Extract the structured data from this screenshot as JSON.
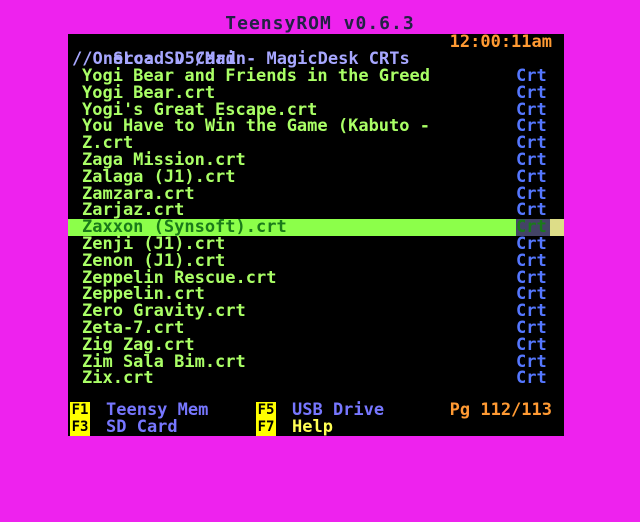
{
  "window": {
    "title": "TeensyROM v0.6.3"
  },
  "header": {
    "source": "Src: SD Card",
    "clock": "12:00:11am",
    "path": "//OneLoad v5/Main- MagicDesk CRTs"
  },
  "files": [
    {
      "name": "Yogi Bear and Friends in the Greed",
      "type": "Crt"
    },
    {
      "name": "Yogi Bear.crt",
      "type": "Crt"
    },
    {
      "name": "Yogi's Great Escape.crt",
      "type": "Crt"
    },
    {
      "name": "You Have to Win the Game (Kabuto -",
      "type": "Crt"
    },
    {
      "name": "Z.crt",
      "type": "Crt"
    },
    {
      "name": "Zaga Mission.crt",
      "type": "Crt"
    },
    {
      "name": "Zalaga (J1).crt",
      "type": "Crt"
    },
    {
      "name": "Zamzara.crt",
      "type": "Crt"
    },
    {
      "name": "Zarjaz.crt",
      "type": "Crt"
    },
    {
      "name": "Zaxxon (Synsoft).crt",
      "type": "Crt",
      "selected": true
    },
    {
      "name": "Zenji (J1).crt",
      "type": "Crt"
    },
    {
      "name": "Zenon (J1).crt",
      "type": "Crt"
    },
    {
      "name": "Zeppelin Rescue.crt",
      "type": "Crt"
    },
    {
      "name": "Zeppelin.crt",
      "type": "Crt"
    },
    {
      "name": "Zero Gravity.crt",
      "type": "Crt"
    },
    {
      "name": "Zeta-7.crt",
      "type": "Crt"
    },
    {
      "name": "Zig Zag.crt",
      "type": "Crt"
    },
    {
      "name": "Zim Sala Bim.crt",
      "type": "Crt"
    },
    {
      "name": "Zix.crt",
      "type": "Crt"
    }
  ],
  "footer": {
    "f1": {
      "key": "F1",
      "label": "Teensy Mem"
    },
    "f3": {
      "key": "F3",
      "label": "SD Card"
    },
    "f5": {
      "key": "F5",
      "label": "USB Drive"
    },
    "f7": {
      "key": "F7",
      "label": "Help"
    },
    "page": "Pg 112/113"
  },
  "colors": {
    "border": "#ee22ee",
    "screen": "#000000",
    "file_text": "#aaff66",
    "type_text": "#5577ff",
    "highlight": "#8cff4a",
    "clock": "#ff9a33",
    "header_text": "#a7a7ff",
    "fkey_bg": "#ffff00"
  }
}
